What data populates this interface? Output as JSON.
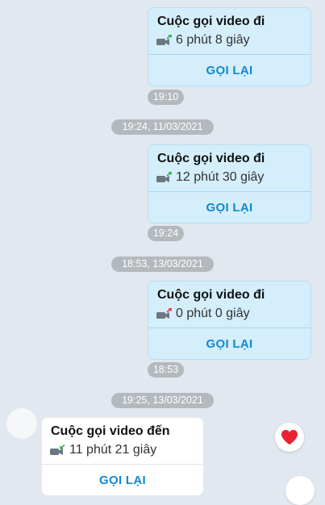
{
  "colors": {
    "accent": "#1088d2",
    "outgoing_bg": "#d5eefc",
    "incoming_bg": "#ffffff",
    "missed": "#e53935",
    "answered": "#2eb34a"
  },
  "messages": [
    {
      "direction": "outgoing",
      "title": "Cuộc gọi video đi",
      "duration": "6 phút 8 giây",
      "action": "GỌI LẠI",
      "status_icon": "outgoing-call-arrow-icon",
      "time": "19:10"
    },
    {
      "divider": "19:24, 11/03/2021"
    },
    {
      "direction": "outgoing",
      "title": "Cuộc gọi video đi",
      "duration": "12 phút 30 giây",
      "action": "GỌI LẠI",
      "status_icon": "outgoing-call-arrow-icon",
      "time": "19:24"
    },
    {
      "divider": "18:53, 13/03/2021"
    },
    {
      "direction": "outgoing",
      "title": "Cuộc gọi video đi",
      "duration": "0 phút 0 giây",
      "action": "GỌI LẠI",
      "status_icon": "missed-call-arrow-icon",
      "time": "18:53"
    },
    {
      "divider": "19:25, 13/03/2021"
    },
    {
      "direction": "incoming",
      "title": "Cuộc gọi video đến",
      "duration": "11 phút 21 giây",
      "action": "GỌI LẠI",
      "status_icon": "incoming-call-arrow-icon"
    }
  ],
  "reactions": {
    "heart": "heart-icon"
  }
}
